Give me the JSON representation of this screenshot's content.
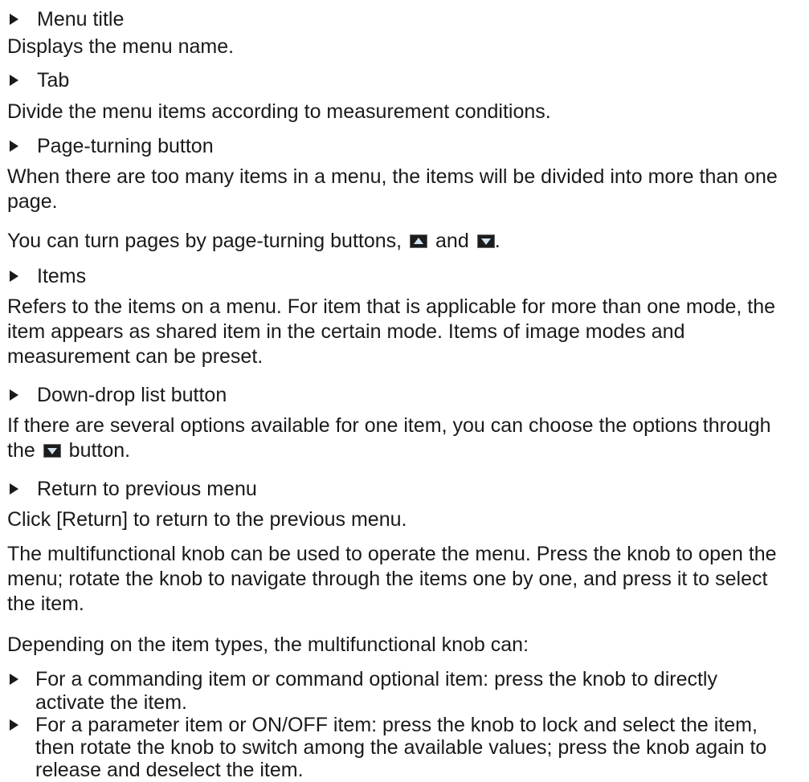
{
  "menu_title": {
    "heading": "Menu title",
    "text": "Displays the menu name."
  },
  "tab": {
    "heading": "Tab",
    "text": "Divide the menu items according to measurement conditions."
  },
  "page_turning": {
    "heading": "Page-turning button",
    "text": "When there are too many items in a menu, the items will be divided into more than one page.",
    "turn_prefix": "You can turn pages by page-turning buttons,",
    "turn_and": "and",
    "turn_suffix": ".",
    "icons": [
      "page-up-icon",
      "page-down-icon"
    ]
  },
  "items": {
    "heading": "Items",
    "text": "Refers to the items on a menu. For item that is applicable for more than one mode, the item appears as shared item in the certain mode. Items of image modes and measurement can be preset."
  },
  "dropdown": {
    "heading": "Down-drop list button",
    "text_before": "If there are several options available for one item, you can choose the options through the",
    "text_after": "button.",
    "icon": "dropdown-arrow-icon"
  },
  "return": {
    "heading": "Return to previous menu",
    "text": "Click [Return] to return to the previous menu."
  },
  "knob_intro": "The multifunctional knob can be used to operate the menu. Press the knob to open the menu; rotate the knob to navigate through the items one by one, and press it to select the item.",
  "knob_depending": "Depending on the item types, the multifunctional knob can:",
  "knob_bullets": [
    "For a commanding item or command optional item: press the knob to directly activate the item.",
    "For a parameter item or ON/OFF item: press the knob to lock and select the item, then rotate the knob to switch among the available values; press the knob again to release and deselect the item."
  ],
  "colors": {
    "text": "#1a1a1a",
    "icon_bg": "#1c1c1c",
    "icon_arrow": "#cfe3f2"
  }
}
